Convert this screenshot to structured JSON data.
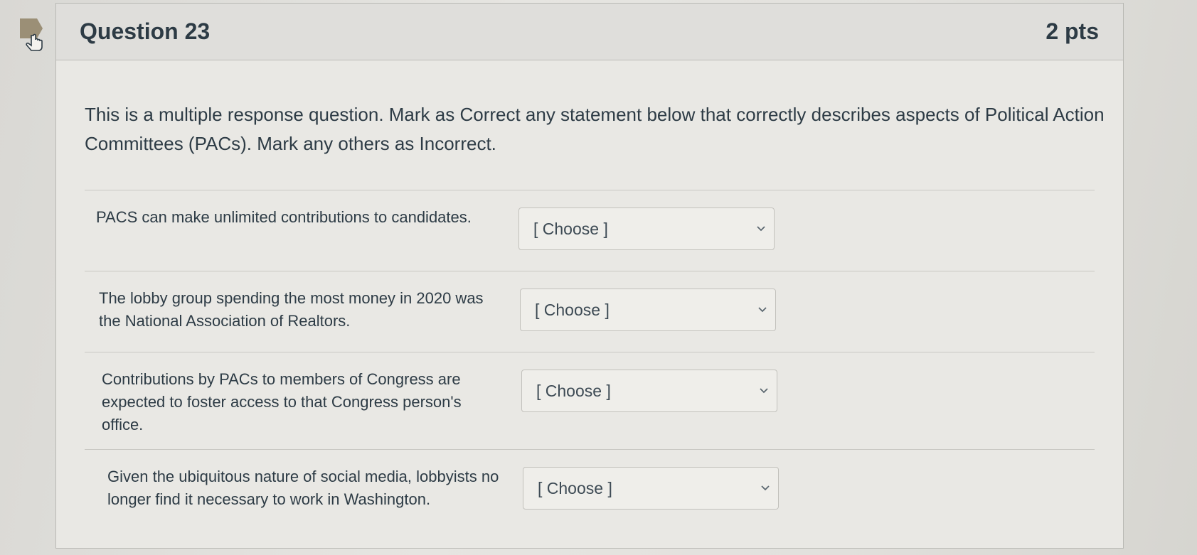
{
  "question": {
    "title": "Question 23",
    "points": "2 pts",
    "prompt": "This is a multiple response question. Mark as Correct any statement below that correctly describes aspects of Political Action Committees (PACs).  Mark any others as Incorrect."
  },
  "answers": [
    {
      "statement": "PACS can make unlimited contributions to candidates.",
      "selected": "[ Choose ]"
    },
    {
      "statement": "The lobby group spending the most money in 2020 was the National Association of Realtors.",
      "selected": "[ Choose ]"
    },
    {
      "statement": "Contributions by PACs to members of Congress are expected to foster access to that Congress person's office.",
      "selected": "[ Choose ]"
    },
    {
      "statement": "Given the ubiquitous nature of social media, lobbyists no longer find it necessary to work in Washington.",
      "selected": "[ Choose ]"
    }
  ],
  "icons": {
    "flag": "bookmark-flag-icon",
    "dropdown": "chevron-down-icon"
  },
  "colors": {
    "flag": "#9b8f76",
    "text": "#2d3b45"
  }
}
